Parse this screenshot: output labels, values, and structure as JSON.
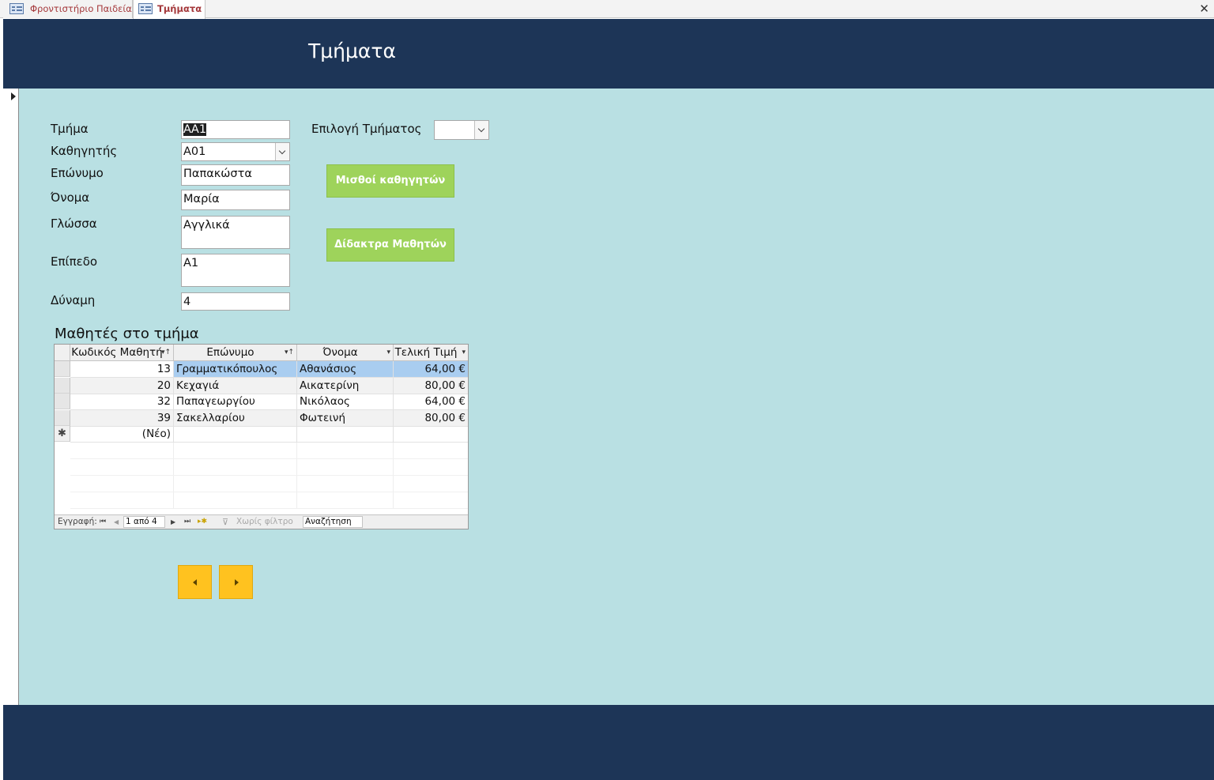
{
  "tabs": [
    {
      "label": "Φροντιστήριο Παιδεία",
      "active": false
    },
    {
      "label": "Τμήματα",
      "active": true
    }
  ],
  "form": {
    "title": "Τμήματα",
    "fields": {
      "tmima": {
        "label": "Τμήμα",
        "value": "ΑΑ1"
      },
      "kathigitis": {
        "label": "Καθηγητής",
        "value": "Α01"
      },
      "eponymo": {
        "label": "Επώνυμο",
        "value": "Παπακώστα"
      },
      "onoma": {
        "label": "Όνομα",
        "value": "Μαρία"
      },
      "glossa": {
        "label": "Γλώσσα",
        "value": "Αγγλικά"
      },
      "epipedo": {
        "label": "Επίπεδο",
        "value": "Α1"
      },
      "dynami": {
        "label": "Δύναμη",
        "value": "4"
      }
    },
    "selector": {
      "label": "Επιλογή Τμήματος",
      "value": ""
    },
    "buttons": {
      "salaries": "Μισθοί καθηγητών",
      "fees": "Δίδακτρα Μαθητών"
    }
  },
  "subform": {
    "title": "Μαθητές στο τμήμα",
    "columns": [
      "Κωδικός Μαθητή",
      "Επώνυμο",
      "Όνομα",
      "Τελική Τιμή"
    ],
    "rows": [
      {
        "id": "13",
        "surname": "Γραμματικόπουλος",
        "name": "Αθανάσιος",
        "price": "64,00 €"
      },
      {
        "id": "20",
        "surname": "Κεχαγιά",
        "name": "Αικατερίνη",
        "price": "80,00 €"
      },
      {
        "id": "32",
        "surname": "Παπαγεωργίου",
        "name": "Νικόλαος",
        "price": "64,00 €"
      },
      {
        "id": "39",
        "surname": "Σακελλαρίου",
        "name": "Φωτεινή",
        "price": "80,00 €"
      }
    ],
    "new_row": "(Νέο)",
    "new_marker": "✱",
    "nav": {
      "record_label": "Εγγραφή:",
      "position": "1 από 4",
      "filter": "Χωρίς φίλτρο",
      "search": "Αναζήτηση"
    }
  },
  "icons": {
    "close": "✕",
    "first": "⏮",
    "prev": "◀",
    "next": "▶",
    "last": "⏭"
  }
}
